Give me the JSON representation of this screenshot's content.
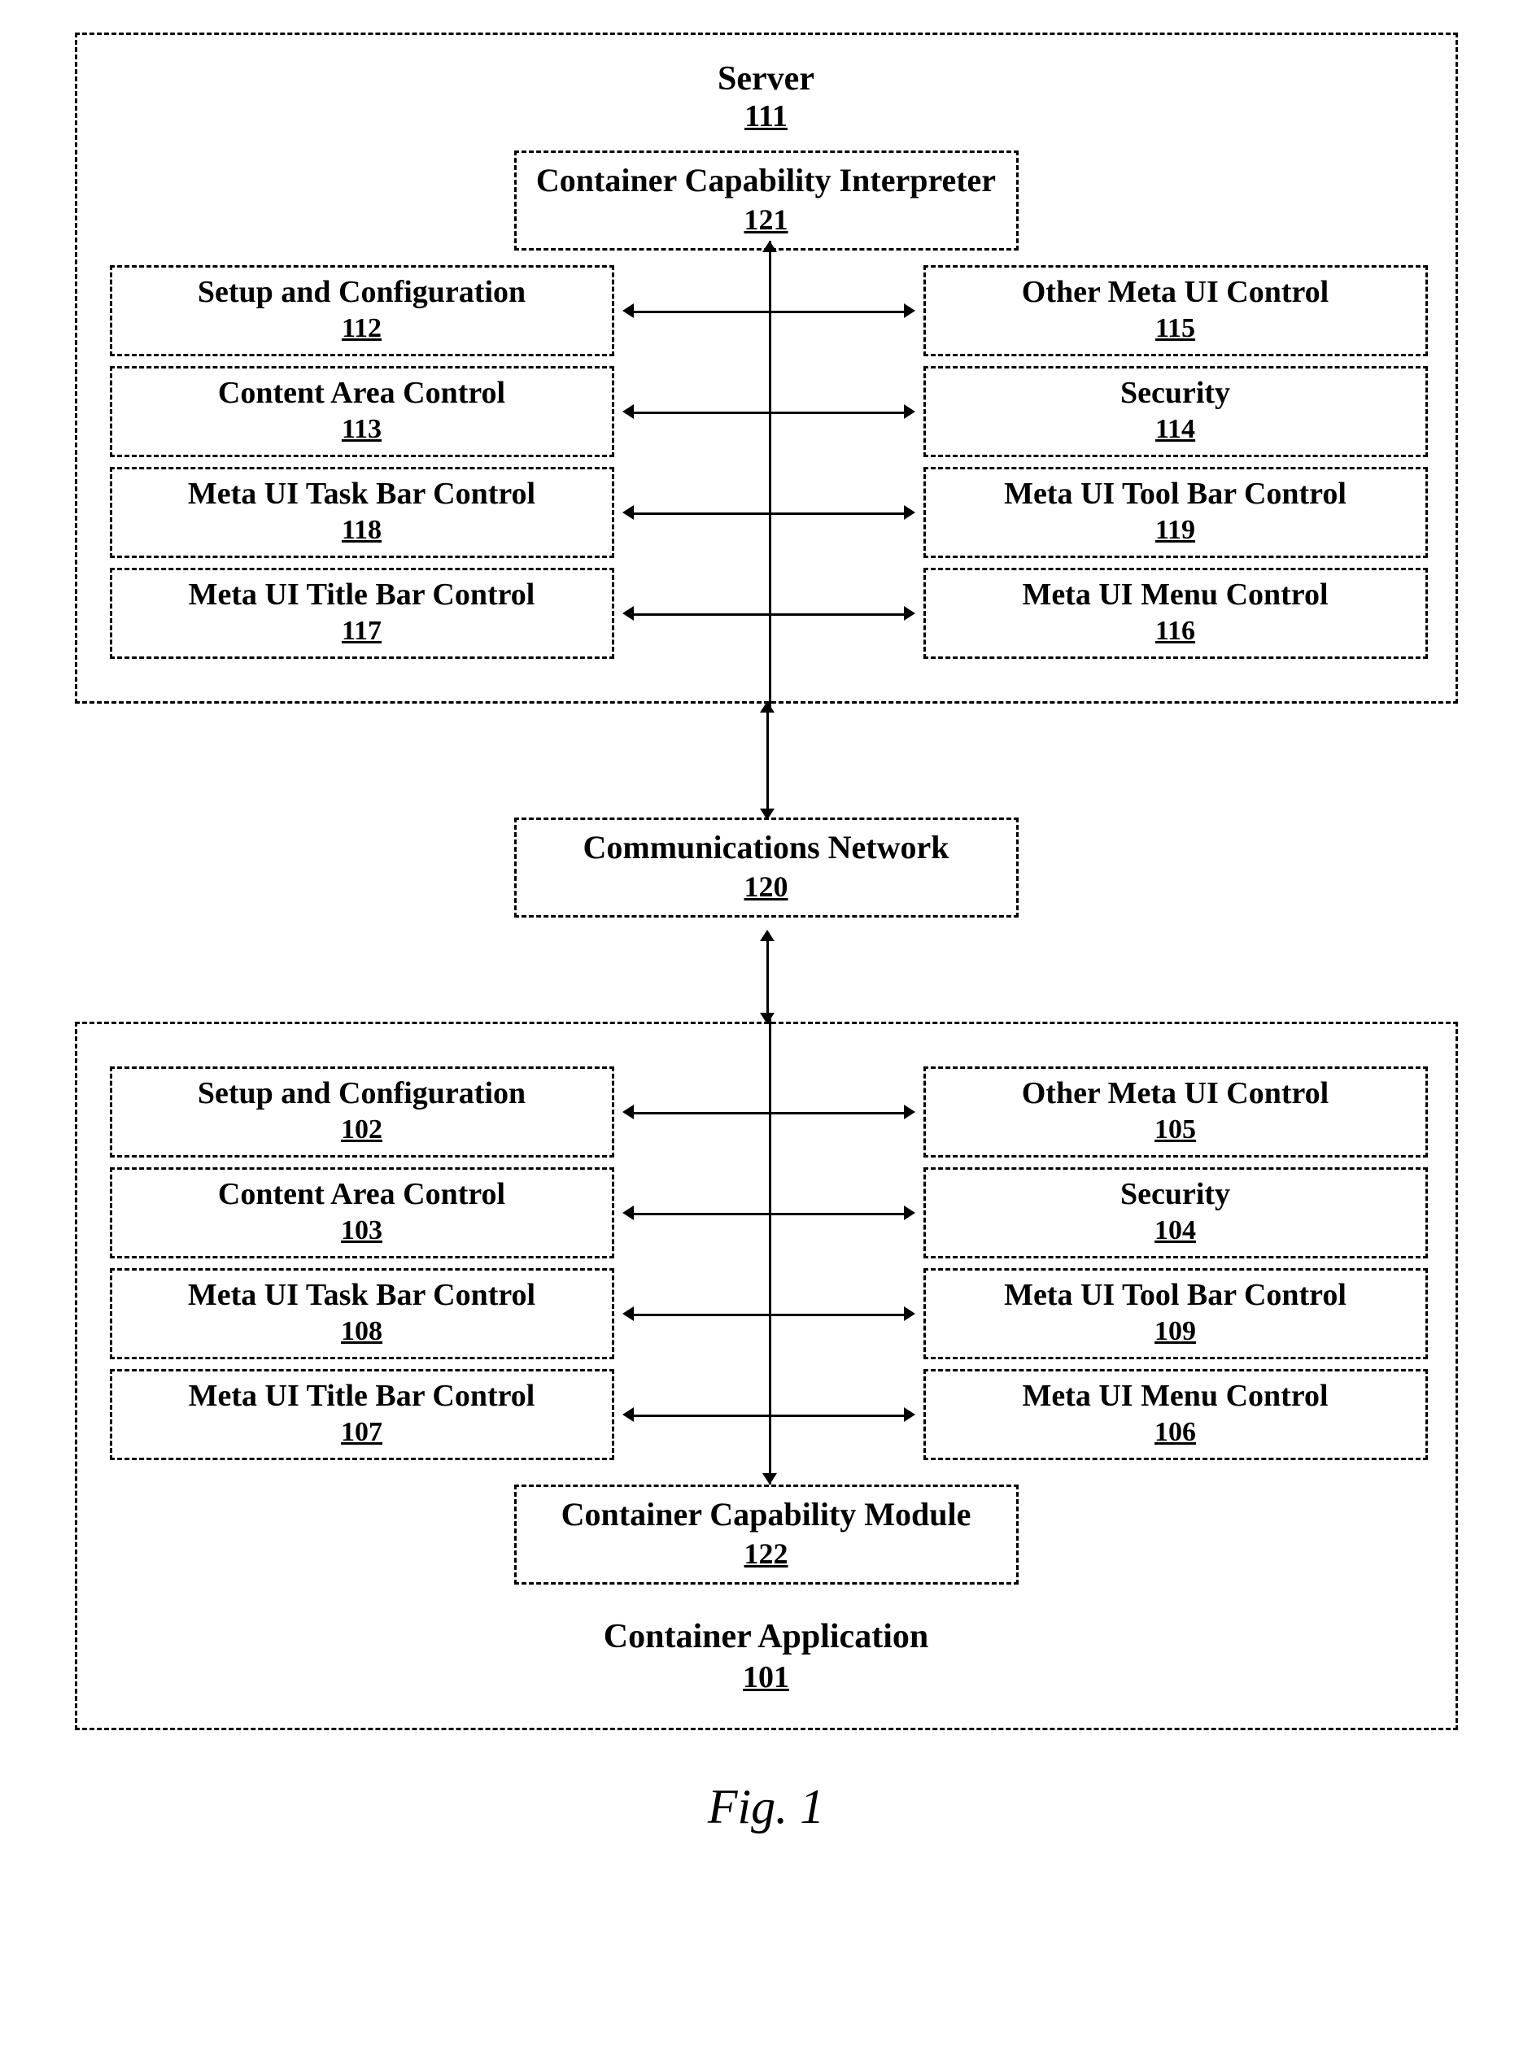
{
  "caption": "Fig. 1",
  "server": {
    "title": "Server",
    "ref": "111",
    "interpreter": {
      "title": "Container Capability Interpreter",
      "ref": "121"
    },
    "rows": [
      {
        "left": {
          "title": "Setup and Configuration",
          "ref": "112"
        },
        "right": {
          "title": "Other Meta UI Control",
          "ref": "115"
        }
      },
      {
        "left": {
          "title": "Content Area Control",
          "ref": "113"
        },
        "right": {
          "title": "Security",
          "ref": "114"
        }
      },
      {
        "left": {
          "title": "Meta UI Task Bar Control",
          "ref": "118"
        },
        "right": {
          "title": "Meta UI Tool Bar Control",
          "ref": "119"
        }
      },
      {
        "left": {
          "title": "Meta UI Title Bar Control",
          "ref": "117"
        },
        "right": {
          "title": "Meta UI Menu Control",
          "ref": "116"
        }
      }
    ]
  },
  "network": {
    "title": "Communications Network",
    "ref": "120"
  },
  "container": {
    "title": "Container Application",
    "ref": "101",
    "module": {
      "title": "Container Capability Module",
      "ref": "122"
    },
    "rows": [
      {
        "left": {
          "title": "Setup and Configuration",
          "ref": "102"
        },
        "right": {
          "title": "Other Meta UI Control",
          "ref": "105"
        }
      },
      {
        "left": {
          "title": "Content Area Control",
          "ref": "103"
        },
        "right": {
          "title": "Security",
          "ref": "104"
        }
      },
      {
        "left": {
          "title": "Meta UI Task Bar Control",
          "ref": "108"
        },
        "right": {
          "title": "Meta UI Tool Bar Control",
          "ref": "109"
        }
      },
      {
        "left": {
          "title": "Meta UI Title Bar Control",
          "ref": "107"
        },
        "right": {
          "title": "Meta UI Menu Control",
          "ref": "106"
        }
      }
    ]
  }
}
